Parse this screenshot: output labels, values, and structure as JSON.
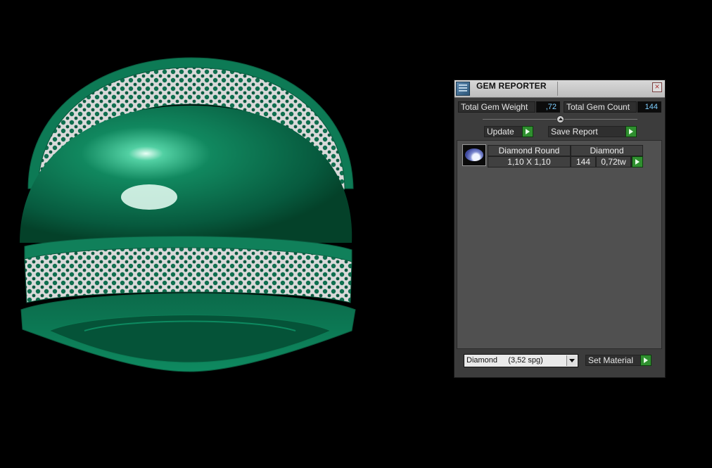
{
  "window": {
    "title": "GEM REPORTER",
    "close_symbol": "×"
  },
  "stats": {
    "total_weight_label": "Total Gem Weight",
    "total_weight_value": ",72",
    "total_count_label": "Total Gem Count",
    "total_count_value": "144"
  },
  "actions": {
    "update_label": "Update",
    "save_report_label": "Save Report"
  },
  "table": {
    "headers": [
      "Diamond Round",
      "Diamond"
    ],
    "rows": [
      {
        "size": "1,10 X 1,10",
        "count": "144",
        "weight": "0,72tw",
        "icon": "diamond-gem-icon"
      }
    ]
  },
  "footer": {
    "material_selected": "Diamond     (3,52 spg)",
    "set_material_label": "Set Material"
  },
  "colors": {
    "accent_green": "#2f8f2f",
    "value_blue": "#7fd0ff",
    "model_green": "#0f7a55"
  }
}
